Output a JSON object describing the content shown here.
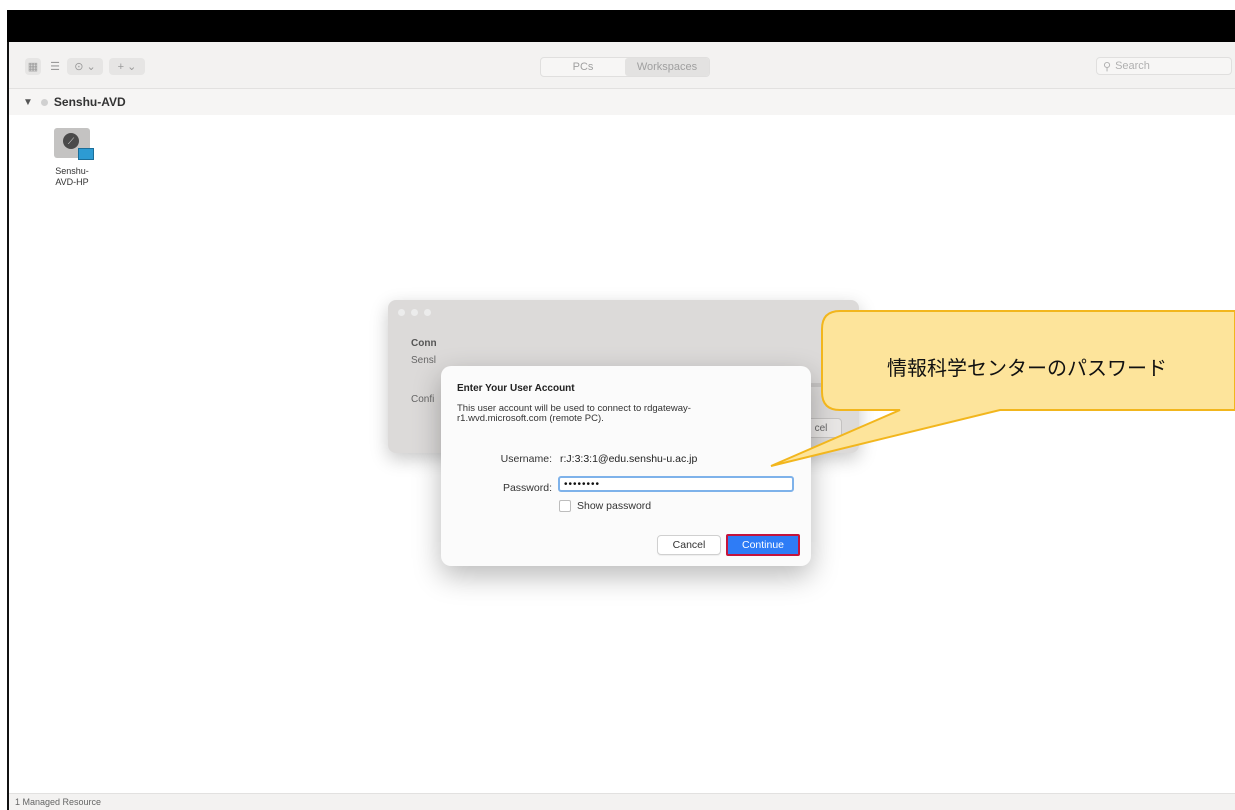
{
  "toolbar": {
    "grid_view_icon": "grid-icon",
    "list_view_icon": "list-icon",
    "more_icon": "ellipsis-circle-icon",
    "add_icon": "plus-icon",
    "tabs": [
      {
        "label": "PCs",
        "active": false
      },
      {
        "label": "Workspaces",
        "active": true
      }
    ],
    "search_placeholder": "Search"
  },
  "workspace": {
    "group_name": "Senshu-AVD",
    "resources": [
      {
        "label": "Senshu-AVD-HP"
      }
    ]
  },
  "background_dialog": {
    "line1": "Conn",
    "line2": "Sensl",
    "line3": "Confi",
    "cancel_label": "cel"
  },
  "account_dialog": {
    "title": "Enter Your User Account",
    "description": "This user account will be used to connect to rdgateway-r1.wvd.microsoft.com (remote PC).",
    "username_label": "Username:",
    "username_value": "r:J:3:3:1@edu.senshu-u.ac.jp",
    "password_label": "Password:",
    "password_value": "••••••••",
    "show_password_label": "Show password",
    "show_password_checked": false,
    "cancel_label": "Cancel",
    "continue_label": "Continue"
  },
  "annotation": {
    "callout_text": "情報科学センターのパスワード",
    "callout_fill": "#fde49b",
    "callout_border": "#f2b61d",
    "highlight_color": "#c4143c"
  },
  "status_bar": {
    "text": "1 Managed Resource"
  }
}
